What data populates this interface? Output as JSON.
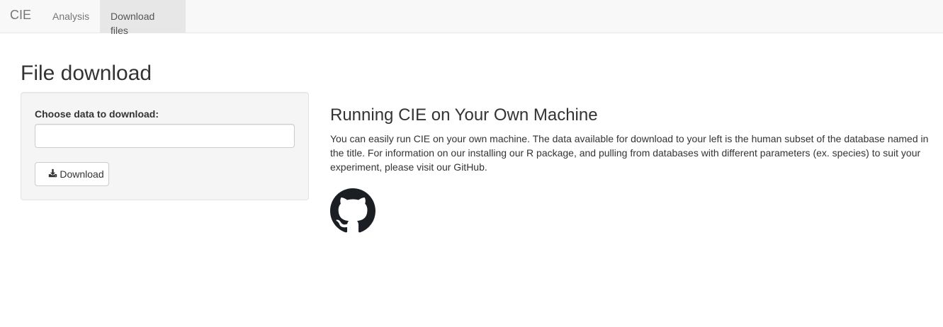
{
  "navbar": {
    "brand": "CIE",
    "tabs": [
      {
        "label": "Analysis",
        "active": false
      },
      {
        "label": "Download files",
        "active": true
      }
    ]
  },
  "main": {
    "title": "File download",
    "panel": {
      "select_label": "Choose data to download:",
      "select_value": "",
      "download_button": "Download",
      "download_icon": "download-icon"
    },
    "info": {
      "heading": "Running CIE on Your Own Machine",
      "body": "You can easily run CIE on your own machine. The data available for download to your left is the human subset of the database named in the title. For information on our installing our R package, and pulling from databases with different parameters (ex. species) to suit your experiment, please visit our GitHub.",
      "link_icon": "github-logo-icon"
    }
  },
  "colors": {
    "navbar_bg": "#f8f8f8",
    "active_tab_bg": "#e7e7e7",
    "well_bg": "#f5f5f5",
    "text": "#333333",
    "muted_text": "#777777",
    "github_logo": "#1b1f23"
  }
}
